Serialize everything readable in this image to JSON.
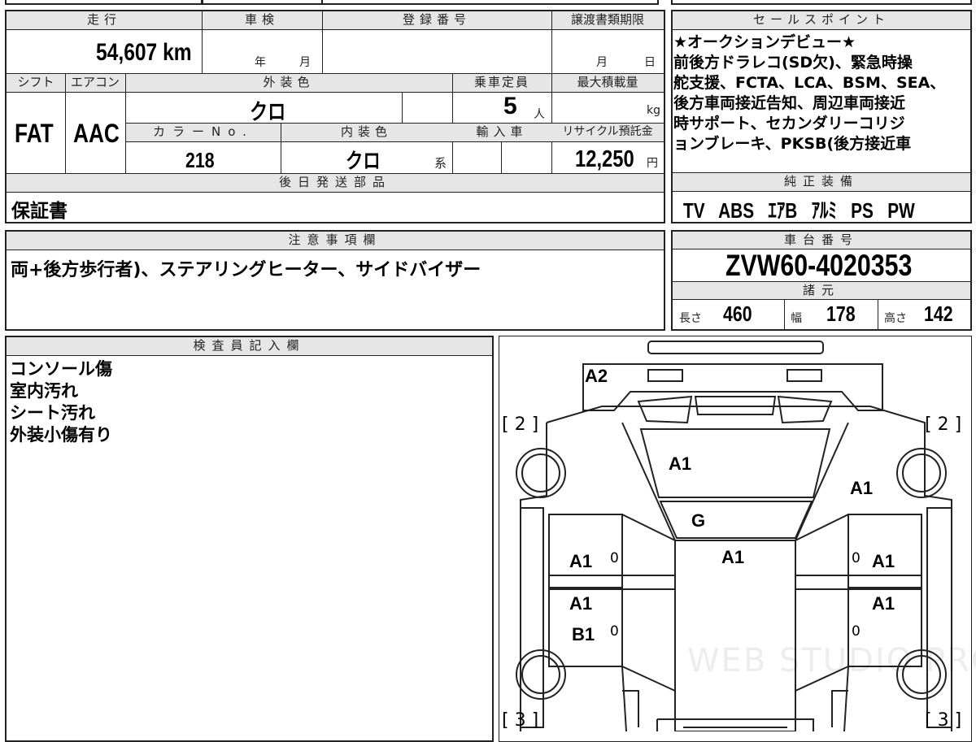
{
  "headers": {
    "mileage": "走行",
    "shaken": "車検",
    "registration": "登録番号",
    "transfer_deadline": "譲渡書類期限",
    "sales_points": "セールスポイント",
    "shift": "シフト",
    "aircon": "エアコン",
    "exterior_color": "外装色",
    "capacity": "乗車定員",
    "max_load": "最大積載量",
    "color_no": "カラーNo.",
    "interior_color": "内装色",
    "import": "輸入車",
    "recycle": "リサイクル預託金",
    "later_parts": "後日発送部品",
    "genuine_equipment": "純正装備",
    "notes": "注意事項欄",
    "chassis": "車台番号",
    "specs": "諸元",
    "inspector": "検査員記入欄"
  },
  "values": {
    "mileage": "54,607 km",
    "shaken_year": "年",
    "shaken_month": "月",
    "transfer_month": "月",
    "transfer_day": "日",
    "shift": "FAT",
    "aircon": "AAC",
    "exterior_color": "クロ",
    "capacity": "5",
    "capacity_unit": "人",
    "max_load_unit": "kg",
    "color_no": "218",
    "interior_color": "クロ",
    "interior_suffix": "系",
    "recycle": "12,250",
    "recycle_unit": "円",
    "later_parts": "保証書",
    "chassis": "ZVW60-4020353"
  },
  "sales_points": [
    "★オークションデビュー★",
    "前後方ドラレコ(SD欠)、緊急時操",
    "舵支援、FCTA、LCA、BSM、SEA、",
    "後方車両接近告知、周辺車両接近",
    "時サポート、セカンダリーコリジ",
    "ョンブレーキ、PKSB(後方接近車"
  ],
  "genuine_equipment": [
    "TV",
    "ABS",
    "ｴｱB",
    "ｱﾙﾐ",
    "PS",
    "PW"
  ],
  "notes_text": "両+後方歩行者)、ステアリングヒーター、サイドバイザー",
  "specs": {
    "length_label": "長さ",
    "length": "460",
    "width_label": "幅",
    "width": "178",
    "height_label": "高さ",
    "height": "142"
  },
  "inspector_notes": [
    "コンソール傷",
    "室内汚れ",
    "シート汚れ",
    "外装小傷有り"
  ],
  "diagram": {
    "bumper_front": "A2",
    "hood": "A1",
    "windshield": "G",
    "roof": "A1",
    "front_fender_right": "A1",
    "front_door_left": "A1",
    "front_door_right": "A1",
    "rear_door_left_1": "A1",
    "rear_door_left_2": "B1",
    "rear_door_right": "A1",
    "zero": "0",
    "tire_front_left": "[ 2 ]",
    "tire_front_right": "[ 2 ]",
    "tire_rear_left": "[ 3 ]",
    "tire_rear_right": "[ 3 ]",
    "watermark": "WEB STUDIO PRO"
  }
}
